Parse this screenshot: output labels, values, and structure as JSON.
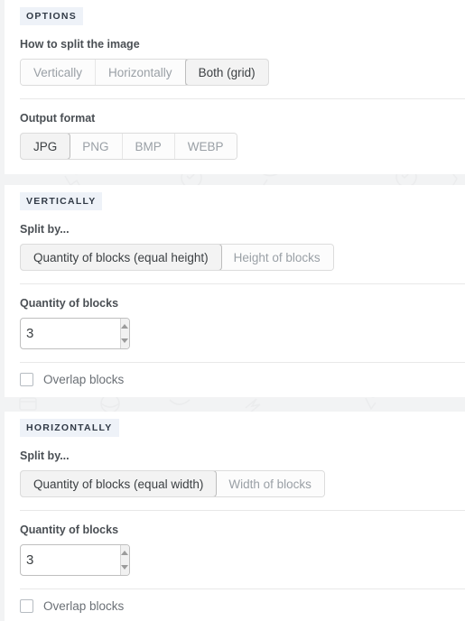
{
  "sections": [
    {
      "badge": "OPTIONS",
      "fields": [
        {
          "label": "How to split the image",
          "type": "segmented",
          "options": [
            "Vertically",
            "Horizontally",
            "Both (grid)"
          ],
          "selected": "Both (grid)"
        },
        {
          "label": "Output format",
          "type": "segmented",
          "options": [
            "JPG",
            "PNG",
            "BMP",
            "WEBP"
          ],
          "selected": "JPG"
        }
      ]
    },
    {
      "badge": "VERTICALLY",
      "fields": [
        {
          "label": "Split by...",
          "type": "segmented",
          "options": [
            "Quantity of blocks (equal height)",
            "Height of blocks"
          ],
          "selected": "Quantity of blocks (equal height)"
        },
        {
          "label": "Quantity of blocks",
          "type": "stepper",
          "value": "3",
          "placeholder": ""
        },
        {
          "label": "Overlap blocks",
          "type": "checkbox",
          "checked": false
        }
      ]
    },
    {
      "badge": "HORIZONTALLY",
      "fields": [
        {
          "label": "Split by...",
          "type": "segmented",
          "options": [
            "Quantity of blocks (equal width)",
            "Width of blocks"
          ],
          "selected": "Quantity of blocks (equal width)"
        },
        {
          "label": "Quantity of blocks",
          "type": "stepper",
          "value": "3",
          "placeholder": ""
        },
        {
          "label": "Overlap blocks",
          "type": "checkbox",
          "checked": false
        }
      ]
    }
  ],
  "icons": {
    "stepper_up": "arrow-up-icon",
    "stepper_down": "arrow-down-icon"
  },
  "colors": {
    "page_bg": "#f2f3f4",
    "card_bg": "#ffffff",
    "badge_bg": "#eef2f8",
    "badge_text": "#313a46",
    "label_text": "#4a4f54",
    "muted_text": "#9aa0a6",
    "active_text": "#3c4043",
    "border": "#dcdcdc",
    "divider": "#e8e8e8"
  }
}
